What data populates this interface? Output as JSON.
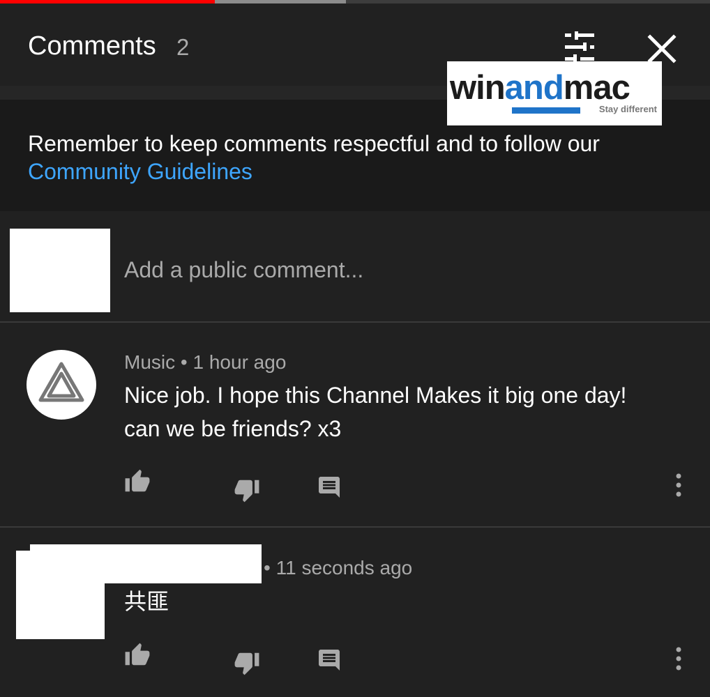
{
  "header": {
    "title": "Comments",
    "count": "2"
  },
  "watermark": {
    "word_start": "win",
    "word_accent": "and",
    "word_end": "mac",
    "tagline": "Stay different"
  },
  "guidelines": {
    "text": "Remember to keep comments respectful and to follow our ",
    "link": "Community Guidelines"
  },
  "compose": {
    "placeholder": "Add a public comment..."
  },
  "comments": [
    {
      "author": "Music",
      "separator": " • ",
      "time": "1 hour ago",
      "text_line1": "Nice job. I hope this Channel Makes it big one day!",
      "text_line2": "can we be friends? x3"
    },
    {
      "separator": "• ",
      "time": "11 seconds ago",
      "text_line1": "共匪"
    }
  ],
  "colors": {
    "background": "#212121",
    "banner": "#1a1a1a",
    "link": "#3ea6ff",
    "muted": "#aaaaaa",
    "progress_played": "#ff0000",
    "logo_accent": "#1f74c9"
  },
  "icons": [
    "sort-filter-icon",
    "close-icon",
    "thumbs-up-icon",
    "thumbs-down-icon",
    "reply-icon",
    "more-vert-icon"
  ],
  "player_progress": {
    "played_fraction": 0.3,
    "buffered_fraction": 0.49
  }
}
